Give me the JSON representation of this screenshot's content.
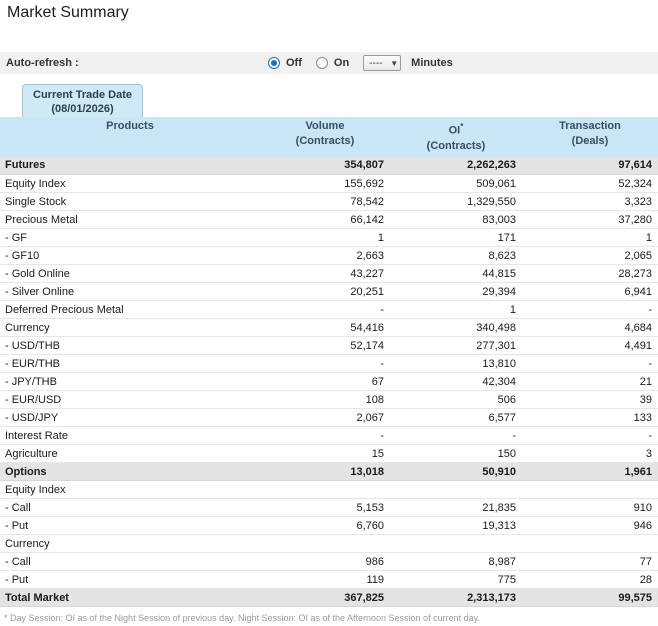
{
  "page": {
    "title": "Market Summary"
  },
  "auto_refresh": {
    "label": "Auto-refresh :",
    "off_label": "Off",
    "on_label": "On",
    "selected": "Off",
    "interval_value": "----",
    "minutes_label": "Minutes"
  },
  "tab": {
    "line1": "Current Trade Date",
    "line2": "(08/01/2026)"
  },
  "table": {
    "headers": [
      {
        "title": "Products",
        "sup": "",
        "sub": ""
      },
      {
        "title": "Volume",
        "sup": "",
        "sub": "(Contracts)"
      },
      {
        "title": "OI",
        "sup": "*",
        "sub": "(Contracts)"
      },
      {
        "title": "Transaction",
        "sup": "",
        "sub": "(Deals)"
      }
    ],
    "rows": [
      {
        "product": "Futures",
        "volume": "354,807",
        "oi": "2,262,263",
        "transaction": "97,614",
        "style": "summary"
      },
      {
        "product": "Equity Index",
        "volume": "155,692",
        "oi": "509,061",
        "transaction": "52,324",
        "style": "normal"
      },
      {
        "product": "Single Stock",
        "volume": "78,542",
        "oi": "1,329,550",
        "transaction": "3,323",
        "style": "normal"
      },
      {
        "product": "Precious Metal",
        "volume": "66,142",
        "oi": "83,003",
        "transaction": "37,280",
        "style": "normal"
      },
      {
        "product": "- GF",
        "volume": "1",
        "oi": "171",
        "transaction": "1",
        "style": "sub"
      },
      {
        "product": "- GF10",
        "volume": "2,663",
        "oi": "8,623",
        "transaction": "2,065",
        "style": "sub"
      },
      {
        "product": "- Gold Online",
        "volume": "43,227",
        "oi": "44,815",
        "transaction": "28,273",
        "style": "sub"
      },
      {
        "product": "- Silver Online",
        "volume": "20,251",
        "oi": "29,394",
        "transaction": "6,941",
        "style": "sub"
      },
      {
        "product": "Deferred Precious Metal",
        "volume": "-",
        "oi": "1",
        "transaction": "-",
        "style": "normal"
      },
      {
        "product": "Currency",
        "volume": "54,416",
        "oi": "340,498",
        "transaction": "4,684",
        "style": "normal"
      },
      {
        "product": "- USD/THB",
        "volume": "52,174",
        "oi": "277,301",
        "transaction": "4,491",
        "style": "sub"
      },
      {
        "product": "- EUR/THB",
        "volume": "-",
        "oi": "13,810",
        "transaction": "-",
        "style": "sub"
      },
      {
        "product": "- JPY/THB",
        "volume": "67",
        "oi": "42,304",
        "transaction": "21",
        "style": "sub"
      },
      {
        "product": "- EUR/USD",
        "volume": "108",
        "oi": "506",
        "transaction": "39",
        "style": "sub"
      },
      {
        "product": "- USD/JPY",
        "volume": "2,067",
        "oi": "6,577",
        "transaction": "133",
        "style": "sub"
      },
      {
        "product": "Interest Rate",
        "volume": "-",
        "oi": "-",
        "transaction": "-",
        "style": "normal"
      },
      {
        "product": "Agriculture",
        "volume": "15",
        "oi": "150",
        "transaction": "3",
        "style": "normal"
      },
      {
        "product": "Options",
        "volume": "13,018",
        "oi": "50,910",
        "transaction": "1,961",
        "style": "summary"
      },
      {
        "product": "Equity Index",
        "volume": "",
        "oi": "",
        "transaction": "",
        "style": "normal"
      },
      {
        "product": "- Call",
        "volume": "5,153",
        "oi": "21,835",
        "transaction": "910",
        "style": "sub"
      },
      {
        "product": "- Put",
        "volume": "6,760",
        "oi": "19,313",
        "transaction": "946",
        "style": "sub"
      },
      {
        "product": "Currency",
        "volume": "",
        "oi": "",
        "transaction": "",
        "style": "normal"
      },
      {
        "product": "- Call",
        "volume": "986",
        "oi": "8,987",
        "transaction": "77",
        "style": "sub"
      },
      {
        "product": "- Put",
        "volume": "119",
        "oi": "775",
        "transaction": "28",
        "style": "sub"
      },
      {
        "product": "Total Market",
        "volume": "367,825",
        "oi": "2,313,173",
        "transaction": "99,575",
        "style": "summary"
      }
    ]
  },
  "footnote": "* Day Session: OI as of the Night Session of previous day. Night Session: OI as of the Afternoon Session of current day.",
  "colors": {
    "header_bg": "#c8e6f5",
    "tab_bg": "#cfe9f7",
    "summary_row_bg": "#e4e4e4",
    "bar_bg": "#f1f1f1",
    "radio_accent": "#1b6ec2",
    "footnote_text": "#9a9a9a"
  }
}
